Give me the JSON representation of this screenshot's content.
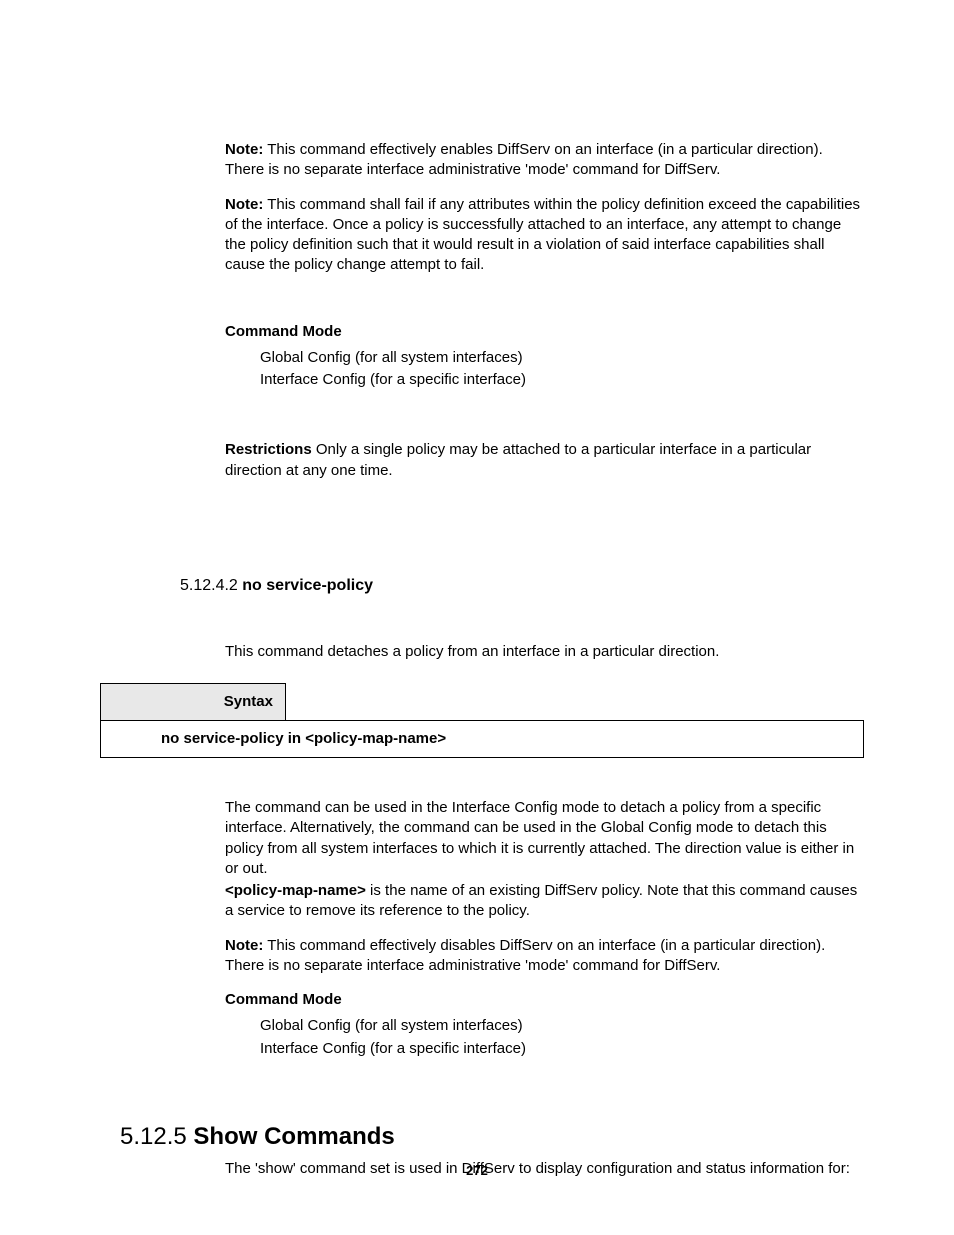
{
  "note1_label": "Note:",
  "note1_text": " This command effectively enables DiffServ on an interface (in a particular direction). There is no separate interface administrative 'mode' command for DiffServ.",
  "note2_label": "Note:",
  "note2_text": " This command shall fail if any attributes within the policy definition exceed the capabilities of the interface. Once a policy is successfully attached to an interface, any attempt to change the policy definition such that it would result in a violation of said interface capabilities shall cause the policy change attempt to fail.",
  "cmd_mode_heading": "Command Mode",
  "cmd_mode_line1": "Global Config (for all system interfaces)",
  "cmd_mode_line2": "Interface Config (for a specific interface)",
  "restrictions_label": "Restrictions",
  "restrictions_text": "   Only a single policy may be attached to a particular interface in a particular direction at any one time.",
  "sec_5_12_4_2_num": "5.12.4.2 ",
  "sec_5_12_4_2_title": "no service-policy",
  "sec_5_12_4_2_intro": "This command detaches a policy from an interface in a particular direction.",
  "syntax_label": "Syntax",
  "syntax_cmd": "no service-policy in <policy-map-name>",
  "para_detach": "The command can be used in the Interface Config mode to detach a policy from a specific interface. Alternatively, the command can be used in the Global Config mode to detach this policy from all system interfaces to which it is currently attached. The direction value is either in or out.",
  "pmn_label": "<policy-map-name>",
  "pmn_text": " is the name of an existing DiffServ policy. Note that this command causes a service to remove its reference to the policy.",
  "note3_label": "Note:",
  "note3_text": " This command effectively disables DiffServ on an interface (in a particular direction). There is no separate interface administrative 'mode' command for DiffServ.",
  "cmd_mode_heading2": "Command Mode",
  "cmd_mode2_line1": "Global Config (for all system interfaces)",
  "cmd_mode2_line2": "Interface Config (for a specific interface)",
  "sec_5_12_5_num": "5.12.5 ",
  "sec_5_12_5_title": "Show Commands",
  "sec_5_12_5_intro": "The 'show' command set is used in DiffServ to display configuration and status information for:",
  "page_number": "272"
}
